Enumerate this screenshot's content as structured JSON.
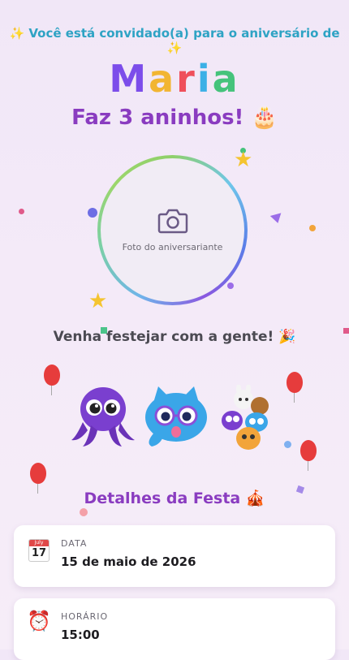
{
  "invite": {
    "prefix_icon": "sparkles-icon",
    "text": "Você está convidado(a) para o aniversário de",
    "suffix_icon": "sparkles-icon"
  },
  "name": {
    "letters": [
      "M",
      "a",
      "r",
      "i",
      "a"
    ]
  },
  "age": {
    "text": "Faz 3 aninhos!",
    "icon": "🎂"
  },
  "photo": {
    "label": "Foto do aniversariante",
    "icon": "camera-icon"
  },
  "cta": {
    "text": "Venha festejar com a gente!",
    "icon": "🎉"
  },
  "details": {
    "title": "Detalhes da Festa",
    "title_icon": "🎪",
    "items": [
      {
        "icon": "calendar-icon",
        "calendar_month": "July",
        "calendar_day": "17",
        "label": "DATA",
        "value": "15 de maio de 2026"
      },
      {
        "icon": "alarm-clock-icon",
        "label": "HORÁRIO",
        "value": "15:00"
      }
    ]
  },
  "colors": {
    "accent": "#8a3cc0",
    "invite": "#2ea3c4"
  }
}
